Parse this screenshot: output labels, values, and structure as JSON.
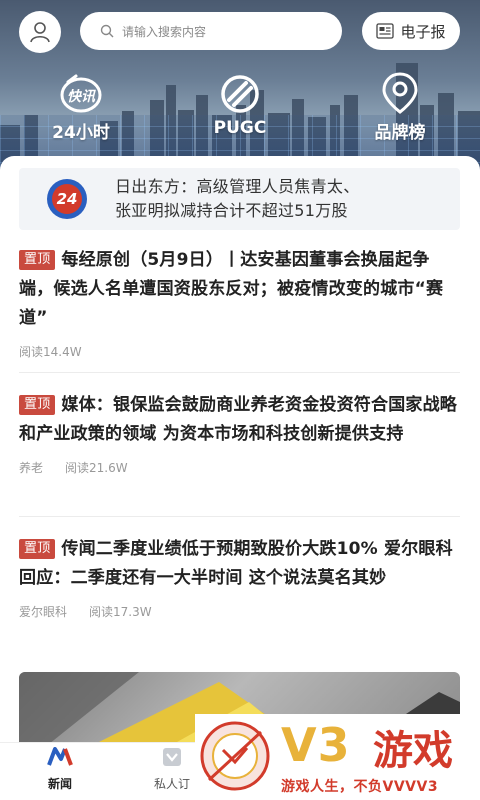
{
  "header": {
    "search_placeholder": "请输入搜索内容",
    "epaper_label": "电子报"
  },
  "quick_links": [
    {
      "label": "24小时",
      "icon": "kuaixun-icon",
      "icon_text": "快讯"
    },
    {
      "label": "PUGC",
      "icon": "pugc-icon"
    },
    {
      "label": "品牌榜",
      "icon": "location-pin-icon"
    }
  ],
  "breaking": {
    "badge": "24",
    "text_line1": "日出东方：高级管理人员焦青太、",
    "text_line2": "张亚明拟减持合计不超过51万股"
  },
  "articles": [
    {
      "pin": "置顶",
      "title": "每经原创（5月9日）丨达安基因董事会换届起争端，候选人名单遭国资股东反对；被疫情改变的城市“赛道”",
      "tag": "",
      "reads": "阅读14.4W"
    },
    {
      "pin": "置顶",
      "title": "媒体：银保监会鼓励商业养老资金投资符合国家战略和产业政策的领域 为资本市场和科技创新提供支持",
      "tag": "养老",
      "reads": "阅读21.6W"
    },
    {
      "pin": "置顶",
      "title": "传闻二季度业绩低于预期致股价大跌10% 爱尔眼科回应：二季度还有一大半时间 这个说法莫名其妙",
      "tag": "爱尔眼科",
      "reads": "阅读17.3W"
    }
  ],
  "tabs": [
    {
      "label": "新闻",
      "icon": "news-logo-icon",
      "active": true
    },
    {
      "label": "私人订",
      "icon": "subscribe-icon",
      "active": false
    }
  ],
  "watermark": {
    "brand": "V3",
    "brand2": "游戏",
    "slogan": "游戏人生，不负VVVV3"
  },
  "colors": {
    "pin_red": "#c94a3e",
    "accent_blue": "#2a5fc0",
    "text_primary": "#222222",
    "text_meta": "#999999"
  }
}
